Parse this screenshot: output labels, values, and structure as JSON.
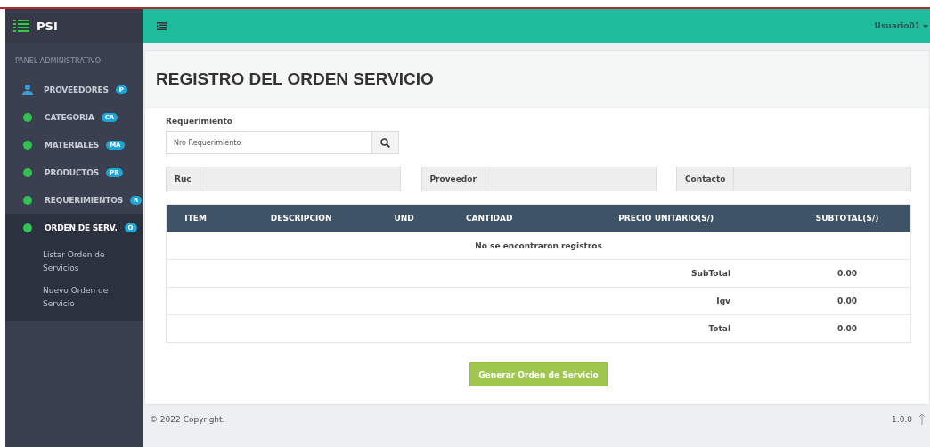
{
  "brand": "PSI",
  "sidebar": {
    "header": "PANEL ADMINISTRATIVO",
    "items": [
      {
        "label": "PROVEEDORES",
        "badge": "P",
        "kind": "user",
        "selected": false
      },
      {
        "label": "CATEGORIA",
        "badge": "CA",
        "kind": "dot",
        "selected": false
      },
      {
        "label": "MATERIALES",
        "badge": "MA",
        "kind": "dot",
        "selected": false
      },
      {
        "label": "PRODUCTOS",
        "badge": "PR",
        "kind": "dot",
        "selected": false
      },
      {
        "label": "REQUERIMIENTOS",
        "badge": "R",
        "kind": "dot",
        "selected": false
      },
      {
        "label": "ORDEN DE SERV.",
        "badge": "O",
        "kind": "dot",
        "selected": true,
        "expanded": true,
        "children": [
          "Listar Orden de Servicios",
          "Nuevo Orden de Servicio"
        ]
      }
    ]
  },
  "topbar": {
    "user": "Usuario01"
  },
  "page_title": "REGISTRO DEL ORDEN SERVICIO",
  "requerimiento": {
    "label": "Requerimiento",
    "placeholder": "Nro Requerimiento"
  },
  "fields": [
    {
      "label": "Ruc"
    },
    {
      "label": "Proveedor"
    },
    {
      "label": "Contacto"
    }
  ],
  "table": {
    "columns": [
      "ITEM",
      "DESCRIPCION",
      "UND",
      "CANTIDAD",
      "PRECIO UNITARIO(S/)",
      "SUBTOTAL(S/)"
    ],
    "empty": "No se encontraron registros",
    "totals": [
      {
        "label": "SubTotal",
        "value": "0.00"
      },
      {
        "label": "Igv",
        "value": "0.00"
      },
      {
        "label": "Total",
        "value": "0.00"
      }
    ]
  },
  "button": "Generar Orden de Servicio",
  "footer": {
    "copyright": "© 2022 Copyright.",
    "version": "1.0.0"
  }
}
